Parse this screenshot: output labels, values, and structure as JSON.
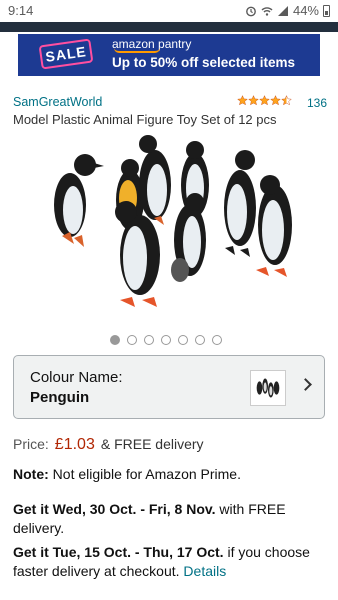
{
  "status": {
    "time": "9:14",
    "battery": "44%"
  },
  "banner": {
    "sale": "SALE",
    "brand": "amazon pantry",
    "offer": "Up to 50% off selected items"
  },
  "product": {
    "seller": "SamGreatWorld",
    "rating_stars": 4.5,
    "rating_count": "136",
    "title": "Model Plastic Animal Figure Toy Set of 12 pcs",
    "image_count": 7,
    "active_image": 0
  },
  "variant": {
    "label": "Colour Name:",
    "value": "Penguin"
  },
  "price": {
    "label": "Price:",
    "amount": "£1.03",
    "suffix": "& FREE delivery"
  },
  "note": {
    "label": "Note:",
    "text": "Not eligible for Amazon Prime."
  },
  "delivery1": {
    "prefix": "Get it ",
    "dates": "Wed, 30 Oct. - Fri, 8 Nov.",
    "suffix": " with FREE delivery."
  },
  "delivery2": {
    "prefix": "Get it ",
    "dates": "Tue, 15 Oct. - Thu, 17 Oct.",
    "suffix": " if you choose faster delivery at checkout. ",
    "link": "Details"
  },
  "colors": {
    "link": "#007185",
    "price": "#b12704",
    "banner_bg": "#1d3a92",
    "star": "#ffa41c"
  }
}
